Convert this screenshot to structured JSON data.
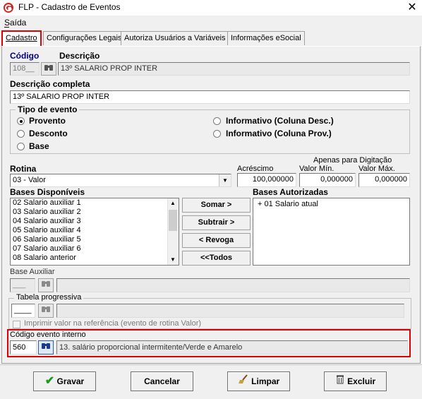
{
  "window": {
    "title": "FLP - Cadastro de Eventos",
    "close_glyph": "✕"
  },
  "menu": {
    "saida": "Saída"
  },
  "tabs": [
    {
      "label": "Cadastro"
    },
    {
      "label": "Configurações Legais"
    },
    {
      "label": "Autoriza Usuários a Variáveis"
    },
    {
      "label": "Informações eSocial"
    }
  ],
  "codigo": {
    "label": "Código",
    "value": "108__"
  },
  "descricao": {
    "label": "Descrição",
    "value": "13º SALARIO PROP INTER"
  },
  "descricao_completa": {
    "label": "Descrição completa",
    "value": "13º SALARIO PROP INTER"
  },
  "tipo_evento": {
    "label": "Tipo de evento",
    "options": [
      {
        "label": "Provento",
        "selected": true
      },
      {
        "label": "Desconto",
        "selected": false
      },
      {
        "label": "Base",
        "selected": false
      },
      {
        "label": "Informativo (Coluna Desc.)",
        "selected": false
      },
      {
        "label": "Informativo (Coluna Prov.)",
        "selected": false
      }
    ]
  },
  "rotina": {
    "label": "Rotina",
    "value": "03 - Valor"
  },
  "acrescimo": {
    "label": "Acréscimo",
    "value": "100,000000"
  },
  "apenas_digitacao": {
    "label": "Apenas para Digitação"
  },
  "valor_min": {
    "label": "Valor Mín.",
    "value": "0,000000"
  },
  "valor_max": {
    "label": "Valor Máx.",
    "value": "0,000000"
  },
  "bases_disponiveis": {
    "label": "Bases Disponíveis",
    "items": [
      "02 Salario auxiliar 1",
      "03 Salario auxiliar 2",
      "04 Salario auxiliar 3",
      "05 Salario auxiliar 4",
      "06 Salario auxiliar 5",
      "07 Salario auxiliar 6",
      "08 Salario anterior"
    ]
  },
  "buttons_transfer": {
    "somar": "Somar >",
    "subtrair": "Subtrair >",
    "revoga": "< Revoga",
    "todos": "<<Todos"
  },
  "bases_autorizadas": {
    "label": "Bases Autorizadas",
    "items": [
      "+ 01 Salario atual"
    ]
  },
  "base_auxiliar": {
    "label": "Base Auxiliar",
    "value": "___"
  },
  "tabela_progressiva": {
    "label": "Tabela progressiva",
    "value": "____",
    "checkbox_label": "Imprimir valor na referência (evento de rotina Valor)"
  },
  "codigo_evento_interno": {
    "label": "Código evento interno",
    "value": "560",
    "description": "13. salário proporcional intermitente/Verde e Amarelo"
  },
  "bottom_buttons": {
    "gravar": "Gravar",
    "cancelar": "Cancelar",
    "limpar": "Limpar",
    "excluir": "Excluir"
  },
  "colors": {
    "highlight_red": "#e00000",
    "gravar_check": "#1a9a1a"
  }
}
